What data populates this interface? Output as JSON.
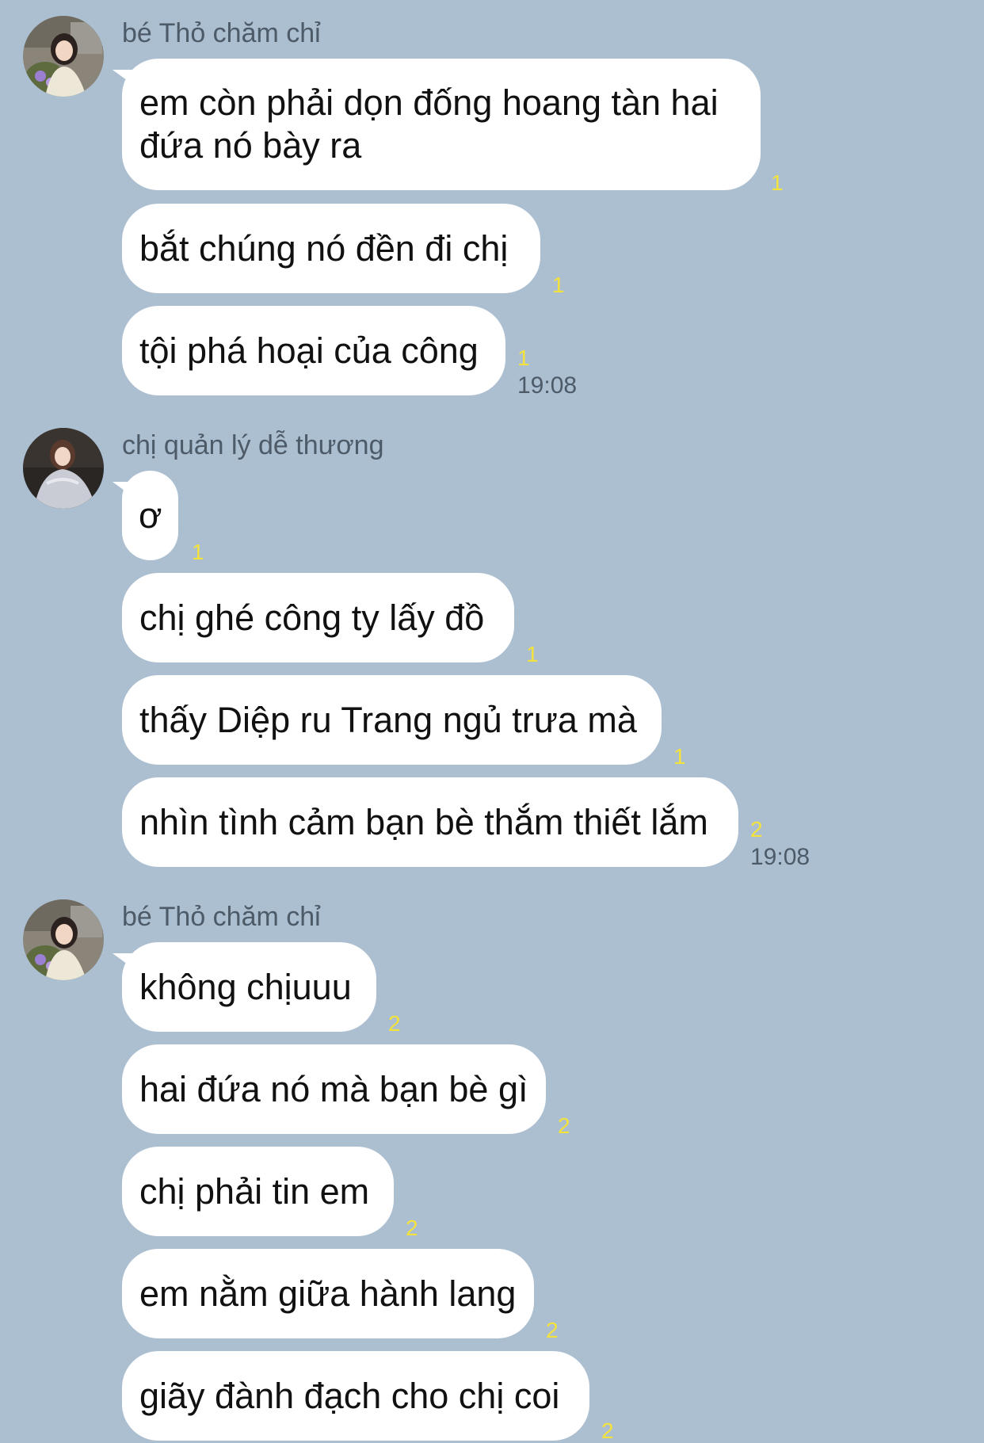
{
  "colors": {
    "background": "#acbfd0",
    "bubble": "#ffffff",
    "read_count": "#f4e23c",
    "meta_text": "#4d5a68"
  },
  "groups": [
    {
      "sender": "bé Thỏ chăm chỉ",
      "avatar_icon": "profile-photo-avatar",
      "time": "19:08",
      "messages": [
        {
          "lines": [
            "em còn phải dọn đống hoang tàn hai",
            "đứa nó bày ra"
          ],
          "read": "1"
        },
        {
          "lines": [
            "bắt chúng nó đền đi chị"
          ],
          "read": "1"
        },
        {
          "lines": [
            "tội phá hoại của công"
          ],
          "read": "1"
        }
      ]
    },
    {
      "sender": "chị quản lý dễ thương",
      "avatar_icon": "profile-photo-avatar",
      "time": "19:08",
      "messages": [
        {
          "lines": [
            "ơ"
          ],
          "read": "1"
        },
        {
          "lines": [
            "chị ghé công ty lấy đồ"
          ],
          "read": "1"
        },
        {
          "lines": [
            "thấy Diệp ru Trang ngủ trưa mà"
          ],
          "read": "1"
        },
        {
          "lines": [
            "nhìn tình cảm bạn bè thắm thiết lắm"
          ],
          "read": "2"
        }
      ]
    },
    {
      "sender": "bé Thỏ chăm chỉ",
      "avatar_icon": "profile-photo-avatar",
      "time": "",
      "messages": [
        {
          "lines": [
            "không chịuuu"
          ],
          "read": "2"
        },
        {
          "lines": [
            "hai đứa nó mà bạn bè gì"
          ],
          "read": "2"
        },
        {
          "lines": [
            "chị phải tin em"
          ],
          "read": "2"
        },
        {
          "lines": [
            "em nằm giữa hành lang"
          ],
          "read": "2"
        },
        {
          "lines": [
            "giãy đành đạch cho chị coi"
          ],
          "read": "2"
        }
      ]
    }
  ]
}
